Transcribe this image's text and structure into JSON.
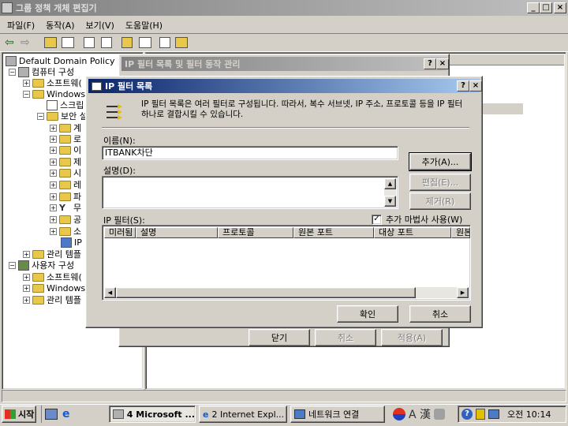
{
  "main_window": {
    "title": "그룹 정책 개체 편집기",
    "menu": [
      "파일(F)",
      "동작(A)",
      "보기(V)",
      "도움말(H)"
    ],
    "tree": [
      "Default Domain Policy [I",
      "컴퓨터 구성",
      "소프트웨(",
      "Windows",
      "스크립",
      "보안 설",
      "계",
      "로",
      "이",
      "제",
      "시",
      "레",
      "파",
      "무",
      "공",
      "소",
      "IP",
      "관리 템플",
      "사용자 구성",
      "소프트웨(",
      "Windows",
      "관리 템플"
    ]
  },
  "outer_dialog": {
    "title": "IP 필터 목록 및 필터 동작 관리",
    "buttons": {
      "close": "닫기",
      "cancel": "취소",
      "apply": "적용(A)"
    }
  },
  "dialog": {
    "title": "IP 필터 목록",
    "description": "IP 필터 목록은 여러 필터로 구성됩니다. 따라서, 복수 서브넷, IP 주소, 프로토콜 등을 IP 필터 하나로 결합시킬 수 있습니다.",
    "name_label": "이름(N):",
    "name_value": "ITBANK차단",
    "desc_label": "설명(D):",
    "desc_value": "",
    "filters_label": "IP 필터(S):",
    "wizard_checkbox": "추가 마법사 사용(W)",
    "wizard_checked": true,
    "columns": [
      "미러됨",
      "설명",
      "프로토콜",
      "원본 포트",
      "대상 포트",
      "원본"
    ],
    "buttons": {
      "add": "추가(A)...",
      "edit": "편집(E)...",
      "remove": "제거(R)",
      "ok": "확인",
      "cancel": "취소"
    }
  },
  "taskbar": {
    "start": "시작",
    "tasks": [
      "4 Microsoft ...",
      "2 Internet Expl...",
      "네트워크 연결"
    ],
    "clock": "오전 10:14",
    "ime": "A 漢"
  }
}
